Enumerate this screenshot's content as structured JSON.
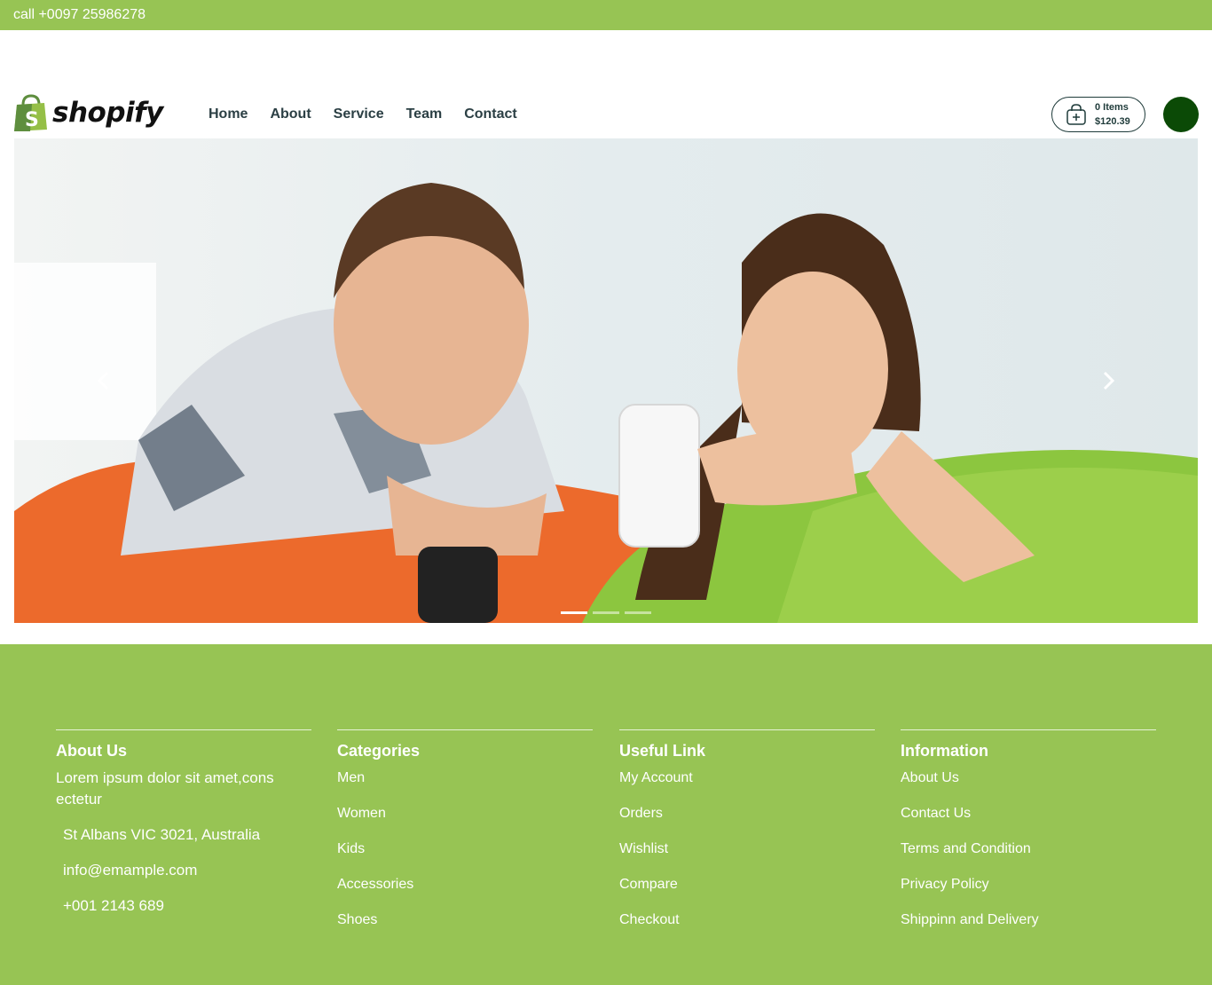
{
  "topbar": {
    "phone_text": "call +0097 25986278"
  },
  "brand": {
    "logo_text": "shopify"
  },
  "nav": [
    "Home",
    "About",
    "Service",
    "Team",
    "Contact"
  ],
  "cart": {
    "items": "0 Items",
    "total": "$120.39"
  },
  "hero": {
    "prev_icon": "chevron-left-icon",
    "next_icon": "chevron-right-icon",
    "slides": 3,
    "active_slide": 1
  },
  "footer": {
    "about": {
      "title": "About Us",
      "text": "Lorem ipsum dolor sit amet,consectetur",
      "address": "St Albans VIC 3021, Australia",
      "email": "info@emample.com",
      "phone": "+001 2143 689"
    },
    "categories": {
      "title": "Categories",
      "items": [
        "Men",
        "Women",
        "Kids",
        "Accessories",
        "Shoes"
      ]
    },
    "useful_link": {
      "title": "Useful Link",
      "items": [
        "My Account",
        "Orders",
        "Wishlist",
        "Compare",
        "Checkout"
      ]
    },
    "information": {
      "title": "Information",
      "items": [
        "About Us",
        "Contact Us",
        "Terms and Condition",
        "Privacy Policy",
        "Shippinn and Delivery"
      ]
    }
  },
  "colors": {
    "accent_green": "#97c454",
    "dark_text": "#1f3b3a",
    "account_button": "#0b4a06"
  }
}
